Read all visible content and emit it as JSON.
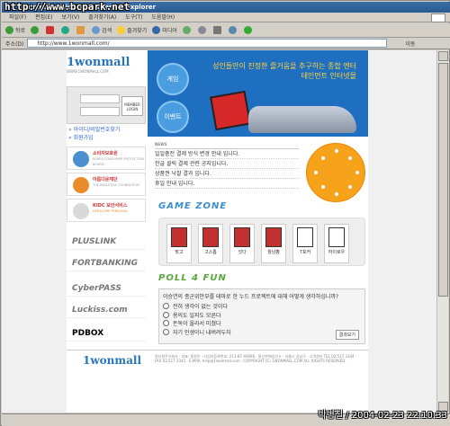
{
  "window": {
    "title": "1wonmall - Microsoft Internet Explorer",
    "watermark": "http://www.bcpark.net"
  },
  "menu": [
    "파일(F)",
    "편집(E)",
    "보기(V)",
    "즐겨찾기(A)",
    "도구(T)",
    "도움말(H)"
  ],
  "toolbar": {
    "back": "뒤로",
    "search": "검색",
    "favorites": "즐겨찾기",
    "media": "미디어"
  },
  "address": {
    "label": "주소(D)",
    "url": "http://www.1wonmall.com/",
    "go": "이동"
  },
  "site": {
    "logo": "1wonmall",
    "logo_sub": "WWW.1WONMALL.COM",
    "login_button": "MEMBER LOGIN",
    "link_find": "아이디/비밀번호찾기",
    "link_join": "회원가입",
    "nav_game": "게임",
    "nav_event": "이벤트",
    "slogan": "성인들만이 진정한 즐거움을 추구하는 종합 엔터테인먼트 인터넷몰",
    "side": [
      {
        "title": "소비자보호원",
        "sub": "KOREA CONSUMER PROTECTION BOARD"
      },
      {
        "title": "아름다운재단",
        "sub": "THE BEAUTIFUL FOUNDATION"
      },
      {
        "title": "KIDC 보안서비스",
        "sub": "LIFESCORE PERSONAL"
      }
    ],
    "partners": [
      "PLUSLINK",
      "FORTBANKING",
      "CyberPASS",
      "Luckiss.com",
      "PDBOX"
    ],
    "news_header": "NEWS",
    "news": [
      "일일충전 결제 방식 변경 안내 입니다.",
      "한글 클릭 결제 관련 공지입니다.",
      "상품권 낙찰 결과 입니다.",
      "휴일 안내 입니다."
    ],
    "game_zone": "GAME ZONE",
    "games": [
      "맞고",
      "고스톱",
      "섯다",
      "월남뽕",
      "7포커",
      "하이로우"
    ],
    "poll_title": "POLL 4 FUN",
    "poll_question": "이승연의 종군위안부를 테마로 한 누드 프로젝트에 대해 어떻게 생각하십니까?",
    "poll_options": [
      "전혀 생각이 없는 것이다",
      "용의도 일지도 모른다",
      "돈독이 올라서 미쳤다",
      "자기 인생이니 내버려두자"
    ],
    "poll_submit": "결과보기",
    "footer_logo": "1wonmall",
    "footer_text": "원신원주식회사 · 대표: 홍원주 · 사업자등록번호: 211-87-40996 · 통신판매업신고 · 서울시 강남구 · 고객센터 TEL 02.517.3344 · FAX 02.517.3345 · E-MAIL help@1wonmall.com · COPYRIGHT (C) 1WONMALL.COM ALL RIGHTS RESERVED."
  },
  "stamp": "박병철 / 2004-02-23 22:10:33"
}
